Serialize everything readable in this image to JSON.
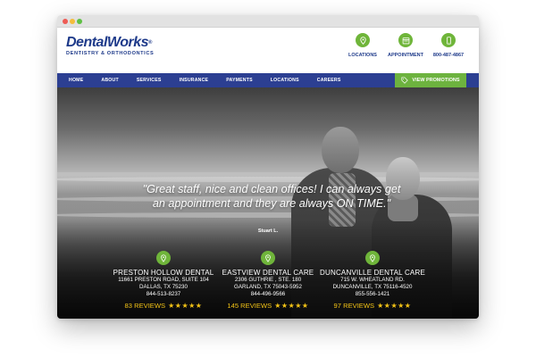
{
  "logo": {
    "main": "DentalWorks",
    "reg": "®",
    "sub": "DENTISTRY & ORTHODONTICS"
  },
  "header_links": [
    {
      "label": "LOCATIONS",
      "icon": "location-pin-icon"
    },
    {
      "label": "APPOINTMENT",
      "icon": "calendar-icon"
    },
    {
      "label": "800-487-4867",
      "icon": "phone-icon"
    }
  ],
  "nav": {
    "items": [
      "HOME",
      "ABOUT",
      "SERVICES",
      "INSURANCE",
      "PAYMENTS",
      "LOCATIONS",
      "CAREERS"
    ],
    "promo_label": "VIEW PROMOTIONS",
    "promo_icon": "tag-icon"
  },
  "hero": {
    "quote": "\"Great staff, nice and clean offices! I can always get an appointment and they are always ON TIME.\"",
    "author": "Stuart L."
  },
  "locations": [
    {
      "name": "PRESTON HOLLOW DENTAL",
      "address1": "11661 PRESTON ROAD, SUITE 104",
      "address2": "DALLAS, TX 75230",
      "phone": "844-513-8237",
      "reviews": "83 REVIEWS",
      "stars": "★★★★★"
    },
    {
      "name": "EASTVIEW DENTAL CARE",
      "address1": "2306 GUTHRIE , STE. 180",
      "address2": "GARLAND, TX 75043-5952",
      "phone": "844-496-9566",
      "reviews": "145 REVIEWS",
      "stars": "★★★★★"
    },
    {
      "name": "DUNCANVILLE DENTAL CARE",
      "address1": "715 W. WHEATLAND RD.",
      "address2": "DUNCANVILLE, TX 75116-4520",
      "phone": "855-556-1421",
      "reviews": "97 REVIEWS",
      "stars": "★★★★★"
    }
  ],
  "colors": {
    "brand_blue": "#2c3f92",
    "accent_green": "#6db33f",
    "star_yellow": "#f3c316"
  }
}
